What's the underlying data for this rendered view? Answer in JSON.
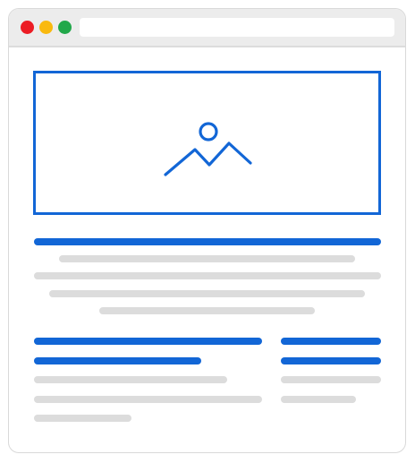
{
  "window": {
    "address_bar": {
      "value": ""
    }
  },
  "colors": {
    "accent": "#1266d6",
    "placeholder_line": "#dcdcdc",
    "traffic_red": "#ec1c24",
    "traffic_yellow": "#f9b90e",
    "traffic_green": "#21a84a",
    "titlebar": "#ececec"
  },
  "hero": {
    "icon": "image-placeholder-icon"
  }
}
